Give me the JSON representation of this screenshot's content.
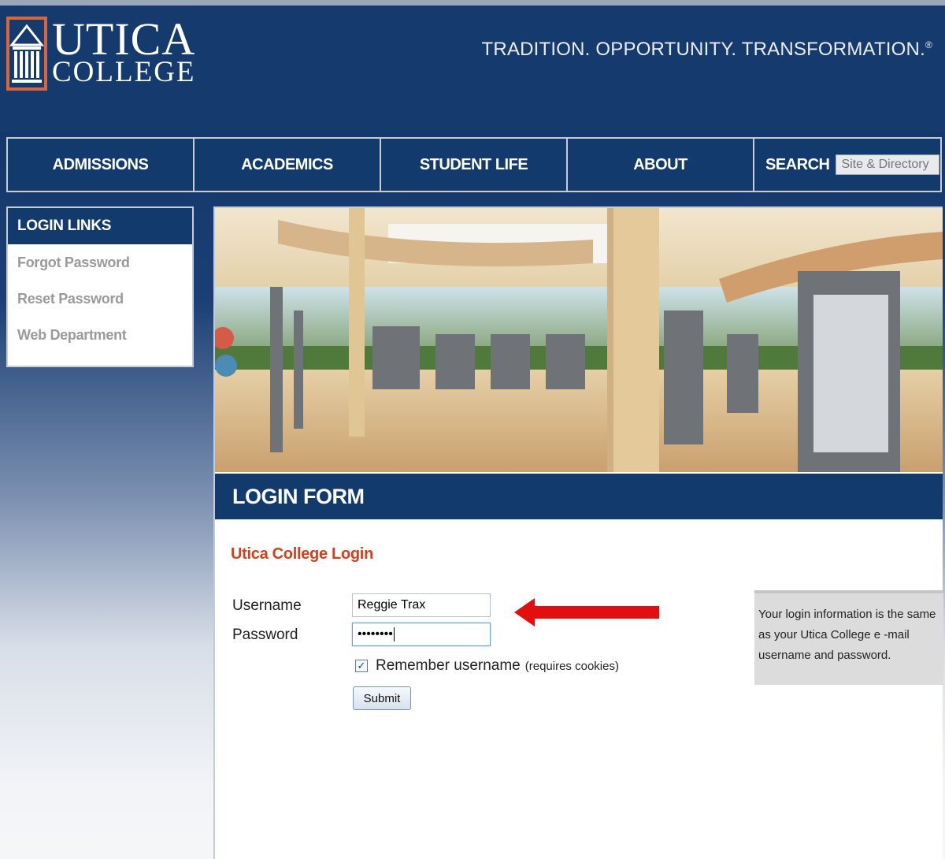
{
  "brand": {
    "logo_line1": "UTICA",
    "logo_line2": "COLLEGE",
    "tagline": "TRADITION. OPPORTUNITY. TRANSFORMATION.",
    "tagline_mark": "®",
    "colors": {
      "navy": "#133a6c",
      "accent_red": "#d2401e",
      "border": "#c5ccd7"
    }
  },
  "nav": {
    "items": [
      {
        "label": "ADMISSIONS"
      },
      {
        "label": "ACADEMICS"
      },
      {
        "label": "STUDENT LIFE"
      },
      {
        "label": "ABOUT"
      }
    ],
    "search_label": "SEARCH",
    "search_placeholder": "Site & Directory"
  },
  "sidebar": {
    "title": "LOGIN LINKS",
    "links": [
      {
        "label": "Forgot Password"
      },
      {
        "label": "Reset Password"
      },
      {
        "label": "Web Department"
      }
    ]
  },
  "form": {
    "header": "LOGIN FORM",
    "title": "Utica College Login",
    "username_label": "Username",
    "username_value": "Reggie Trax",
    "password_label": "Password",
    "password_value": "••••••••",
    "remember_label": "Remember username",
    "remember_note": "(requires cookies)",
    "remember_checked": true,
    "submit_label": "Submit",
    "info_text": "Your login information is the same as your Utica College e -mail username and password."
  },
  "annotation": {
    "icon": "red-arrow-icon",
    "color": "#e30e0e"
  }
}
